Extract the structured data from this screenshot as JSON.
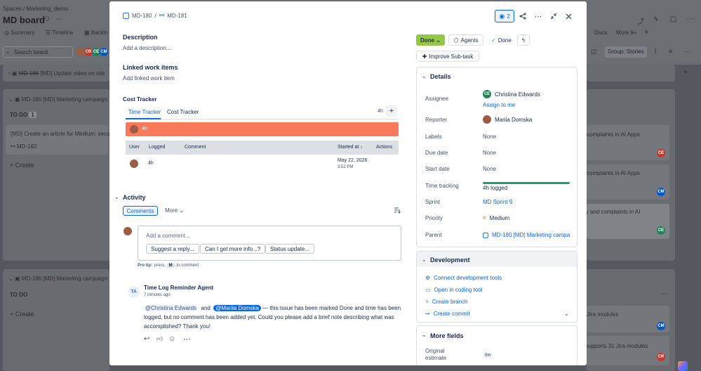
{
  "background": {
    "breadcrumb": [
      "Spaces",
      "/",
      "Marketing_demo"
    ],
    "board_title": "MD board",
    "nav_tabs": [
      "Summary",
      "Timeline",
      "Backlo"
    ],
    "nav_right": [
      "Docs",
      "More",
      "9+"
    ],
    "search_placeholder": "Search board",
    "group_label": "Group: Stories",
    "groups": [
      {
        "key": "MD-166",
        "title": "[MD] Update video on site"
      },
      {
        "key": "MD-180",
        "title": "[MD] Marketing campaign:"
      },
      {
        "key": "MD-186",
        "title": "[MD] Marketing campaign:"
      }
    ],
    "todo_label": "TO DO",
    "todo_count": "1",
    "card": {
      "title": "[MD] Create an article for Medium: secur",
      "key": "MD-182"
    },
    "create_label": "Create",
    "right_cards": [
      "complaints in AI Apps",
      "complaints in AI Apps",
      "rity and complaints in AI",
      "Jira modules",
      "supports 31 Jira modules"
    ],
    "avatars": [
      "CE",
      "CM",
      "CE",
      "CM",
      "CE"
    ]
  },
  "modal": {
    "breadcrumb": {
      "parent": "MD-180",
      "sep": "/",
      "current": "MD-181"
    },
    "watch_count": "2",
    "description": {
      "heading": "Description",
      "placeholder": "Add a description..."
    },
    "linked": {
      "heading": "Linked work items",
      "add": "Add linked work item"
    },
    "cost_tracker": {
      "heading": "Cost Tracker",
      "tabs": [
        "Time Tracker",
        "Cost Tracker"
      ],
      "total": "4h",
      "bar_label": "4h",
      "columns": [
        "User",
        "Logged",
        "Comment",
        "Started at",
        "Actions"
      ],
      "sort_arrow": "↓",
      "rows": [
        {
          "logged": "4h",
          "comment": "",
          "date": "May 22, 2026",
          "time": "3:52 PM"
        }
      ]
    },
    "activity": {
      "heading": "Activity",
      "filter": "Comments",
      "more": "More",
      "comment_placeholder": "Add a comment...",
      "suggestions": [
        "Suggest a reply...",
        "Can I get more info...?",
        "Status update..."
      ],
      "pro_tip": {
        "prefix": "Pro tip:",
        "press": "press",
        "key": "M",
        "suffix": "to comment"
      },
      "entry": {
        "initials": "TA",
        "author": "Time Log Reminder Agent",
        "time": "7 minutes ago",
        "mention1": "@Christina Edwards",
        "and": "and",
        "mention2": "@Mariia Domska",
        "body1": "— this issue has been marked Done and time has been",
        "body2": "logged, but no comment has been added yet. Could you please add a brief note describing what was",
        "body3": "accomplished? Thank you!"
      }
    },
    "status": {
      "label": "Done",
      "color": "#94c748"
    },
    "agents_label": "Agents",
    "resolution": "Done",
    "improve_label": "Improve Sub-task",
    "details": {
      "heading": "Details",
      "rows": [
        {
          "label": "Assignee",
          "value": "Christina Edwards",
          "initials": "CE",
          "action": "Assign to me"
        },
        {
          "label": "Reporter",
          "value": "Mariia Domska"
        },
        {
          "label": "Labels",
          "value": "None"
        },
        {
          "label": "Due date",
          "value": "None"
        },
        {
          "label": "Start date",
          "value": "None"
        },
        {
          "label": "Time tracking",
          "value": "4h logged",
          "progress": 1.0
        },
        {
          "label": "Sprint",
          "value": "MD Sprint 9"
        },
        {
          "label": "Priority",
          "value": "Medium"
        },
        {
          "label": "Parent",
          "value": "MD-180 [MD] Marketing campa"
        }
      ]
    },
    "development": {
      "heading": "Development",
      "items": [
        "Connect development tools",
        "Open in coding tool",
        "Create branch",
        "Create commit"
      ]
    },
    "more_fields": {
      "heading": "More fields",
      "original_estimate_label": [
        "Original",
        "estimate"
      ],
      "original_estimate_value": "0m"
    }
  },
  "colors": {
    "accent": "#0c66e4",
    "bar": "#f97a5a",
    "progress": "#22a06b",
    "ce": "#1f845a",
    "cm": "#0055cc",
    "cr": "#c9372c"
  }
}
